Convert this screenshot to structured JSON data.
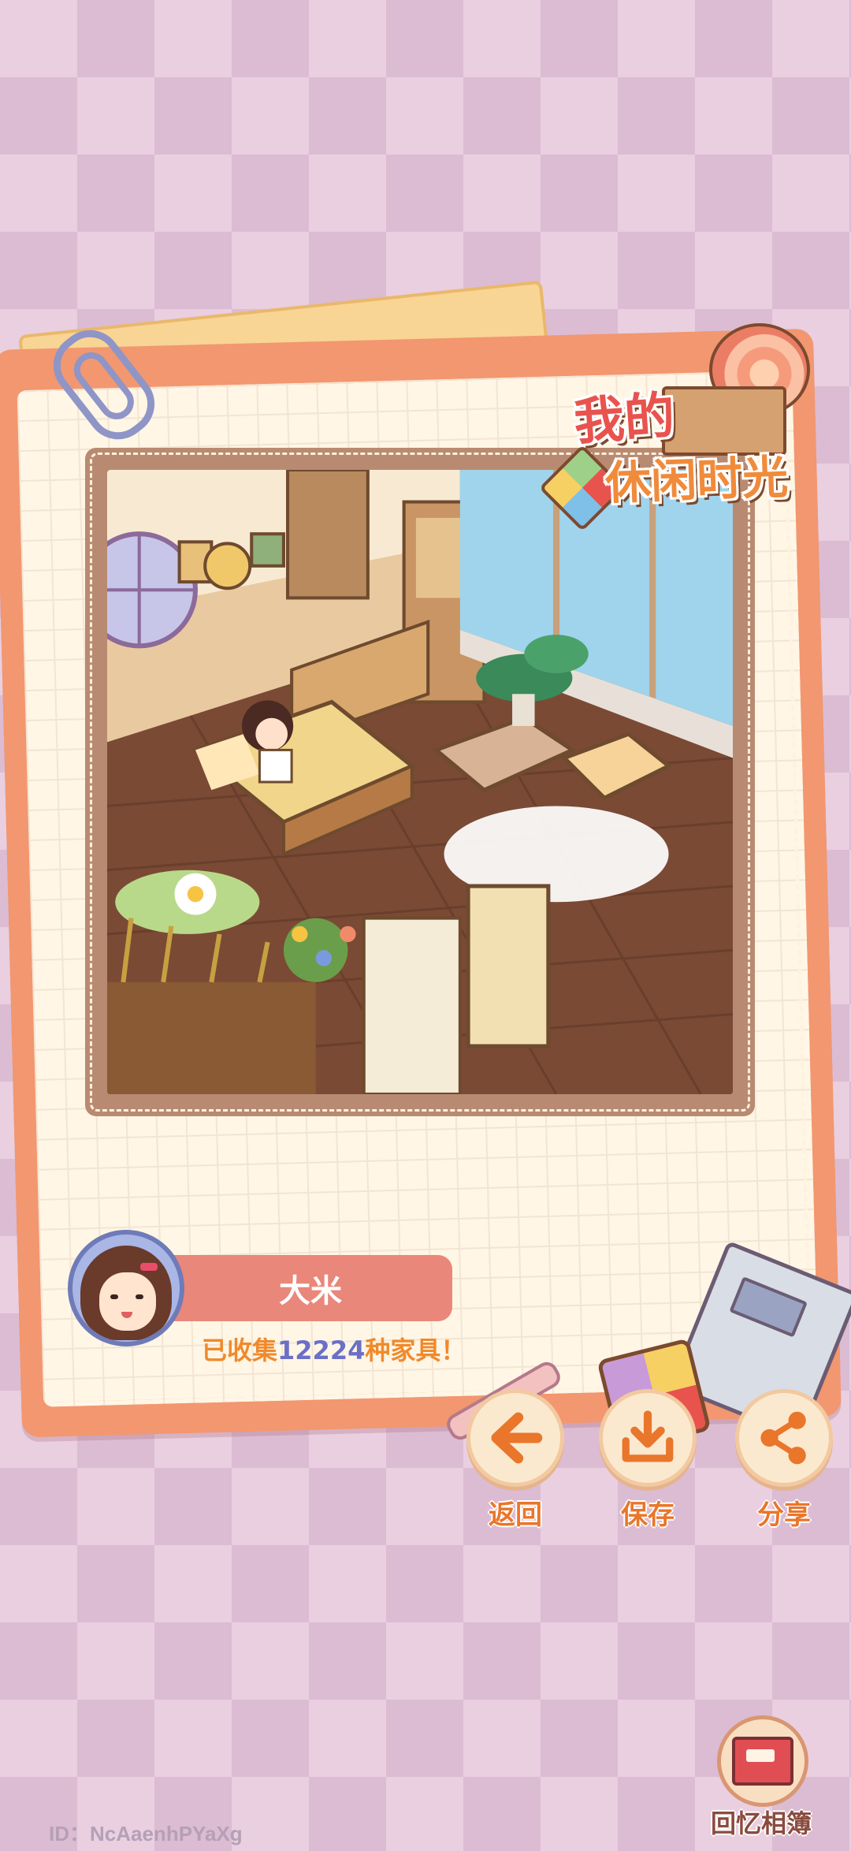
{
  "title": {
    "line1": "我的",
    "line2": "休闲时光"
  },
  "player": {
    "name": "大米",
    "collect_prefix": "已收集",
    "collect_count": "12224",
    "collect_suffix": "种家具！"
  },
  "actions": [
    {
      "label": "返回",
      "icon": "arrow-left-icon"
    },
    {
      "label": "保存",
      "icon": "download-icon"
    },
    {
      "label": "分享",
      "icon": "share-icon"
    }
  ],
  "album": {
    "label": "回忆相簿",
    "icon": "photo-album-icon"
  },
  "id_text": "ID：NcAaenhPYaXg",
  "colors": {
    "card": "#f2976f",
    "paper": "#fff6e6",
    "accent_orange": "#e9762a",
    "title_red": "#e9534e",
    "name_bar": "#e9877a",
    "count_blue": "#6b6fc6"
  }
}
